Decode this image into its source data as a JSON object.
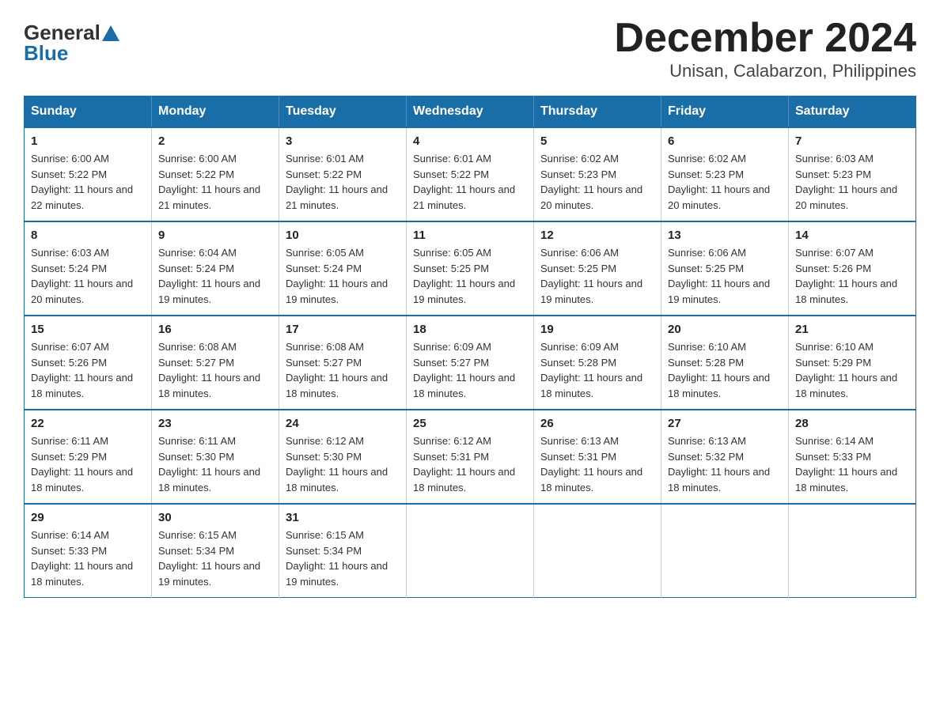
{
  "logo": {
    "general": "General",
    "blue": "Blue"
  },
  "title": "December 2024",
  "subtitle": "Unisan, Calabarzon, Philippines",
  "days_of_week": [
    "Sunday",
    "Monday",
    "Tuesday",
    "Wednesday",
    "Thursday",
    "Friday",
    "Saturday"
  ],
  "weeks": [
    [
      {
        "day": "1",
        "sunrise": "Sunrise: 6:00 AM",
        "sunset": "Sunset: 5:22 PM",
        "daylight": "Daylight: 11 hours and 22 minutes."
      },
      {
        "day": "2",
        "sunrise": "Sunrise: 6:00 AM",
        "sunset": "Sunset: 5:22 PM",
        "daylight": "Daylight: 11 hours and 21 minutes."
      },
      {
        "day": "3",
        "sunrise": "Sunrise: 6:01 AM",
        "sunset": "Sunset: 5:22 PM",
        "daylight": "Daylight: 11 hours and 21 minutes."
      },
      {
        "day": "4",
        "sunrise": "Sunrise: 6:01 AM",
        "sunset": "Sunset: 5:22 PM",
        "daylight": "Daylight: 11 hours and 21 minutes."
      },
      {
        "day": "5",
        "sunrise": "Sunrise: 6:02 AM",
        "sunset": "Sunset: 5:23 PM",
        "daylight": "Daylight: 11 hours and 20 minutes."
      },
      {
        "day": "6",
        "sunrise": "Sunrise: 6:02 AM",
        "sunset": "Sunset: 5:23 PM",
        "daylight": "Daylight: 11 hours and 20 minutes."
      },
      {
        "day": "7",
        "sunrise": "Sunrise: 6:03 AM",
        "sunset": "Sunset: 5:23 PM",
        "daylight": "Daylight: 11 hours and 20 minutes."
      }
    ],
    [
      {
        "day": "8",
        "sunrise": "Sunrise: 6:03 AM",
        "sunset": "Sunset: 5:24 PM",
        "daylight": "Daylight: 11 hours and 20 minutes."
      },
      {
        "day": "9",
        "sunrise": "Sunrise: 6:04 AM",
        "sunset": "Sunset: 5:24 PM",
        "daylight": "Daylight: 11 hours and 19 minutes."
      },
      {
        "day": "10",
        "sunrise": "Sunrise: 6:05 AM",
        "sunset": "Sunset: 5:24 PM",
        "daylight": "Daylight: 11 hours and 19 minutes."
      },
      {
        "day": "11",
        "sunrise": "Sunrise: 6:05 AM",
        "sunset": "Sunset: 5:25 PM",
        "daylight": "Daylight: 11 hours and 19 minutes."
      },
      {
        "day": "12",
        "sunrise": "Sunrise: 6:06 AM",
        "sunset": "Sunset: 5:25 PM",
        "daylight": "Daylight: 11 hours and 19 minutes."
      },
      {
        "day": "13",
        "sunrise": "Sunrise: 6:06 AM",
        "sunset": "Sunset: 5:25 PM",
        "daylight": "Daylight: 11 hours and 19 minutes."
      },
      {
        "day": "14",
        "sunrise": "Sunrise: 6:07 AM",
        "sunset": "Sunset: 5:26 PM",
        "daylight": "Daylight: 11 hours and 18 minutes."
      }
    ],
    [
      {
        "day": "15",
        "sunrise": "Sunrise: 6:07 AM",
        "sunset": "Sunset: 5:26 PM",
        "daylight": "Daylight: 11 hours and 18 minutes."
      },
      {
        "day": "16",
        "sunrise": "Sunrise: 6:08 AM",
        "sunset": "Sunset: 5:27 PM",
        "daylight": "Daylight: 11 hours and 18 minutes."
      },
      {
        "day": "17",
        "sunrise": "Sunrise: 6:08 AM",
        "sunset": "Sunset: 5:27 PM",
        "daylight": "Daylight: 11 hours and 18 minutes."
      },
      {
        "day": "18",
        "sunrise": "Sunrise: 6:09 AM",
        "sunset": "Sunset: 5:27 PM",
        "daylight": "Daylight: 11 hours and 18 minutes."
      },
      {
        "day": "19",
        "sunrise": "Sunrise: 6:09 AM",
        "sunset": "Sunset: 5:28 PM",
        "daylight": "Daylight: 11 hours and 18 minutes."
      },
      {
        "day": "20",
        "sunrise": "Sunrise: 6:10 AM",
        "sunset": "Sunset: 5:28 PM",
        "daylight": "Daylight: 11 hours and 18 minutes."
      },
      {
        "day": "21",
        "sunrise": "Sunrise: 6:10 AM",
        "sunset": "Sunset: 5:29 PM",
        "daylight": "Daylight: 11 hours and 18 minutes."
      }
    ],
    [
      {
        "day": "22",
        "sunrise": "Sunrise: 6:11 AM",
        "sunset": "Sunset: 5:29 PM",
        "daylight": "Daylight: 11 hours and 18 minutes."
      },
      {
        "day": "23",
        "sunrise": "Sunrise: 6:11 AM",
        "sunset": "Sunset: 5:30 PM",
        "daylight": "Daylight: 11 hours and 18 minutes."
      },
      {
        "day": "24",
        "sunrise": "Sunrise: 6:12 AM",
        "sunset": "Sunset: 5:30 PM",
        "daylight": "Daylight: 11 hours and 18 minutes."
      },
      {
        "day": "25",
        "sunrise": "Sunrise: 6:12 AM",
        "sunset": "Sunset: 5:31 PM",
        "daylight": "Daylight: 11 hours and 18 minutes."
      },
      {
        "day": "26",
        "sunrise": "Sunrise: 6:13 AM",
        "sunset": "Sunset: 5:31 PM",
        "daylight": "Daylight: 11 hours and 18 minutes."
      },
      {
        "day": "27",
        "sunrise": "Sunrise: 6:13 AM",
        "sunset": "Sunset: 5:32 PM",
        "daylight": "Daylight: 11 hours and 18 minutes."
      },
      {
        "day": "28",
        "sunrise": "Sunrise: 6:14 AM",
        "sunset": "Sunset: 5:33 PM",
        "daylight": "Daylight: 11 hours and 18 minutes."
      }
    ],
    [
      {
        "day": "29",
        "sunrise": "Sunrise: 6:14 AM",
        "sunset": "Sunset: 5:33 PM",
        "daylight": "Daylight: 11 hours and 18 minutes."
      },
      {
        "day": "30",
        "sunrise": "Sunrise: 6:15 AM",
        "sunset": "Sunset: 5:34 PM",
        "daylight": "Daylight: 11 hours and 19 minutes."
      },
      {
        "day": "31",
        "sunrise": "Sunrise: 6:15 AM",
        "sunset": "Sunset: 5:34 PM",
        "daylight": "Daylight: 11 hours and 19 minutes."
      },
      null,
      null,
      null,
      null
    ]
  ]
}
